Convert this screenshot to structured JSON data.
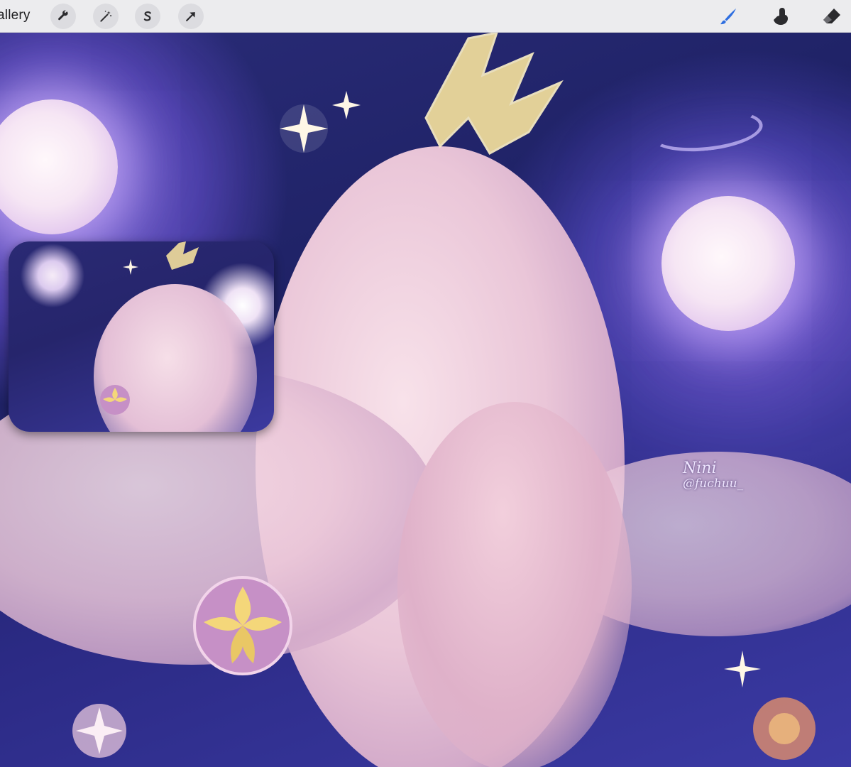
{
  "toolbar": {
    "gallery_label": "Gallery",
    "gallery_visible_text": "allery",
    "left_tools": [
      {
        "name": "actions",
        "icon": "wrench-icon"
      },
      {
        "name": "adjustments",
        "icon": "magic-wand-icon"
      },
      {
        "name": "selection",
        "icon": "selection-s-icon"
      },
      {
        "name": "transform",
        "icon": "arrow-cursor-icon"
      }
    ],
    "right_tools": [
      {
        "name": "brush",
        "icon": "brush-icon",
        "active": true
      },
      {
        "name": "smudge",
        "icon": "smudge-finger-icon",
        "active": false
      },
      {
        "name": "eraser",
        "icon": "eraser-icon",
        "active": false
      }
    ]
  },
  "canvas": {
    "signature_name": "Nini",
    "signature_handle": "@fuchuu_"
  },
  "colors": {
    "toolbar_bg": "#ececee",
    "active_tool": "#2f6fe0",
    "night_sky": "#2a2c78"
  }
}
